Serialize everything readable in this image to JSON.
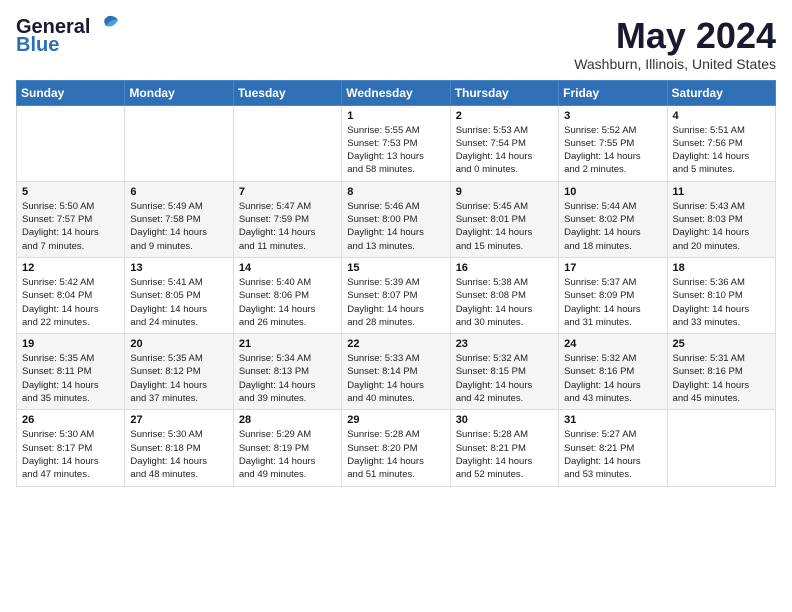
{
  "logo": {
    "text_general": "General",
    "text_blue": "Blue"
  },
  "title": "May 2024",
  "location": "Washburn, Illinois, United States",
  "days_of_week": [
    "Sunday",
    "Monday",
    "Tuesday",
    "Wednesday",
    "Thursday",
    "Friday",
    "Saturday"
  ],
  "weeks": [
    [
      {
        "day": "",
        "info": ""
      },
      {
        "day": "",
        "info": ""
      },
      {
        "day": "",
        "info": ""
      },
      {
        "day": "1",
        "info": "Sunrise: 5:55 AM\nSunset: 7:53 PM\nDaylight: 13 hours\nand 58 minutes."
      },
      {
        "day": "2",
        "info": "Sunrise: 5:53 AM\nSunset: 7:54 PM\nDaylight: 14 hours\nand 0 minutes."
      },
      {
        "day": "3",
        "info": "Sunrise: 5:52 AM\nSunset: 7:55 PM\nDaylight: 14 hours\nand 2 minutes."
      },
      {
        "day": "4",
        "info": "Sunrise: 5:51 AM\nSunset: 7:56 PM\nDaylight: 14 hours\nand 5 minutes."
      }
    ],
    [
      {
        "day": "5",
        "info": "Sunrise: 5:50 AM\nSunset: 7:57 PM\nDaylight: 14 hours\nand 7 minutes."
      },
      {
        "day": "6",
        "info": "Sunrise: 5:49 AM\nSunset: 7:58 PM\nDaylight: 14 hours\nand 9 minutes."
      },
      {
        "day": "7",
        "info": "Sunrise: 5:47 AM\nSunset: 7:59 PM\nDaylight: 14 hours\nand 11 minutes."
      },
      {
        "day": "8",
        "info": "Sunrise: 5:46 AM\nSunset: 8:00 PM\nDaylight: 14 hours\nand 13 minutes."
      },
      {
        "day": "9",
        "info": "Sunrise: 5:45 AM\nSunset: 8:01 PM\nDaylight: 14 hours\nand 15 minutes."
      },
      {
        "day": "10",
        "info": "Sunrise: 5:44 AM\nSunset: 8:02 PM\nDaylight: 14 hours\nand 18 minutes."
      },
      {
        "day": "11",
        "info": "Sunrise: 5:43 AM\nSunset: 8:03 PM\nDaylight: 14 hours\nand 20 minutes."
      }
    ],
    [
      {
        "day": "12",
        "info": "Sunrise: 5:42 AM\nSunset: 8:04 PM\nDaylight: 14 hours\nand 22 minutes."
      },
      {
        "day": "13",
        "info": "Sunrise: 5:41 AM\nSunset: 8:05 PM\nDaylight: 14 hours\nand 24 minutes."
      },
      {
        "day": "14",
        "info": "Sunrise: 5:40 AM\nSunset: 8:06 PM\nDaylight: 14 hours\nand 26 minutes."
      },
      {
        "day": "15",
        "info": "Sunrise: 5:39 AM\nSunset: 8:07 PM\nDaylight: 14 hours\nand 28 minutes."
      },
      {
        "day": "16",
        "info": "Sunrise: 5:38 AM\nSunset: 8:08 PM\nDaylight: 14 hours\nand 30 minutes."
      },
      {
        "day": "17",
        "info": "Sunrise: 5:37 AM\nSunset: 8:09 PM\nDaylight: 14 hours\nand 31 minutes."
      },
      {
        "day": "18",
        "info": "Sunrise: 5:36 AM\nSunset: 8:10 PM\nDaylight: 14 hours\nand 33 minutes."
      }
    ],
    [
      {
        "day": "19",
        "info": "Sunrise: 5:35 AM\nSunset: 8:11 PM\nDaylight: 14 hours\nand 35 minutes."
      },
      {
        "day": "20",
        "info": "Sunrise: 5:35 AM\nSunset: 8:12 PM\nDaylight: 14 hours\nand 37 minutes."
      },
      {
        "day": "21",
        "info": "Sunrise: 5:34 AM\nSunset: 8:13 PM\nDaylight: 14 hours\nand 39 minutes."
      },
      {
        "day": "22",
        "info": "Sunrise: 5:33 AM\nSunset: 8:14 PM\nDaylight: 14 hours\nand 40 minutes."
      },
      {
        "day": "23",
        "info": "Sunrise: 5:32 AM\nSunset: 8:15 PM\nDaylight: 14 hours\nand 42 minutes."
      },
      {
        "day": "24",
        "info": "Sunrise: 5:32 AM\nSunset: 8:16 PM\nDaylight: 14 hours\nand 43 minutes."
      },
      {
        "day": "25",
        "info": "Sunrise: 5:31 AM\nSunset: 8:16 PM\nDaylight: 14 hours\nand 45 minutes."
      }
    ],
    [
      {
        "day": "26",
        "info": "Sunrise: 5:30 AM\nSunset: 8:17 PM\nDaylight: 14 hours\nand 47 minutes."
      },
      {
        "day": "27",
        "info": "Sunrise: 5:30 AM\nSunset: 8:18 PM\nDaylight: 14 hours\nand 48 minutes."
      },
      {
        "day": "28",
        "info": "Sunrise: 5:29 AM\nSunset: 8:19 PM\nDaylight: 14 hours\nand 49 minutes."
      },
      {
        "day": "29",
        "info": "Sunrise: 5:28 AM\nSunset: 8:20 PM\nDaylight: 14 hours\nand 51 minutes."
      },
      {
        "day": "30",
        "info": "Sunrise: 5:28 AM\nSunset: 8:21 PM\nDaylight: 14 hours\nand 52 minutes."
      },
      {
        "day": "31",
        "info": "Sunrise: 5:27 AM\nSunset: 8:21 PM\nDaylight: 14 hours\nand 53 minutes."
      },
      {
        "day": "",
        "info": ""
      }
    ]
  ]
}
